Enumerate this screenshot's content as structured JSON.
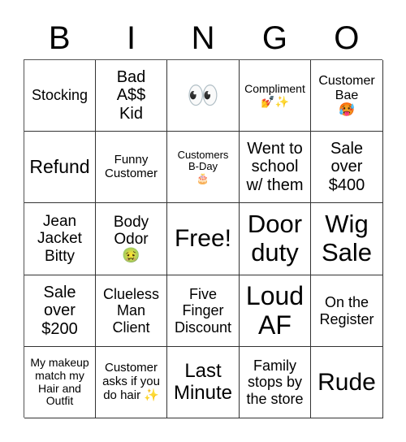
{
  "header": {
    "letters": [
      "B",
      "I",
      "N",
      "G",
      "O"
    ]
  },
  "board": {
    "rows": [
      [
        {
          "text": "Stocking",
          "emoji": ""
        },
        {
          "text": "Bad A$$ Kid",
          "emoji": ""
        },
        {
          "text": "",
          "emoji": "👀",
          "icon": "eyes-icon"
        },
        {
          "text": "Compliment",
          "emoji": "💅✨",
          "icon": "nail-polish-sparkles-icon"
        },
        {
          "text": "Customer Bae",
          "emoji": "🥵",
          "icon": "hot-face-icon"
        }
      ],
      [
        {
          "text": "Refund",
          "emoji": ""
        },
        {
          "text": "Funny Customer",
          "emoji": ""
        },
        {
          "text": "Customers B-Day",
          "emoji": "🎂",
          "icon": "birthday-cake-icon"
        },
        {
          "text": "Went to school w/ them",
          "emoji": ""
        },
        {
          "text": "Sale over $400",
          "emoji": ""
        }
      ],
      [
        {
          "text": "Jean Jacket Bitty",
          "emoji": ""
        },
        {
          "text": "Body Odor",
          "emoji": "🤢",
          "icon": "nauseated-face-icon"
        },
        {
          "text": "Free!",
          "emoji": ""
        },
        {
          "text": "Door duty",
          "emoji": ""
        },
        {
          "text": "Wig Sale",
          "emoji": ""
        }
      ],
      [
        {
          "text": "Sale over $200",
          "emoji": ""
        },
        {
          "text": "Clueless Man Client",
          "emoji": ""
        },
        {
          "text": "Five Finger Discount",
          "emoji": ""
        },
        {
          "text": "Loud AF",
          "emoji": ""
        },
        {
          "text": "On the Register",
          "emoji": ""
        }
      ],
      [
        {
          "text": "My makeup match my Hair and Outfit",
          "emoji": ""
        },
        {
          "text": "Customer asks if you do hair",
          "emoji": "✨",
          "icon": "sparkles-icon"
        },
        {
          "text": "Last Minute",
          "emoji": ""
        },
        {
          "text": "Family stops by the store",
          "emoji": ""
        },
        {
          "text": "Rude",
          "emoji": ""
        }
      ]
    ]
  }
}
